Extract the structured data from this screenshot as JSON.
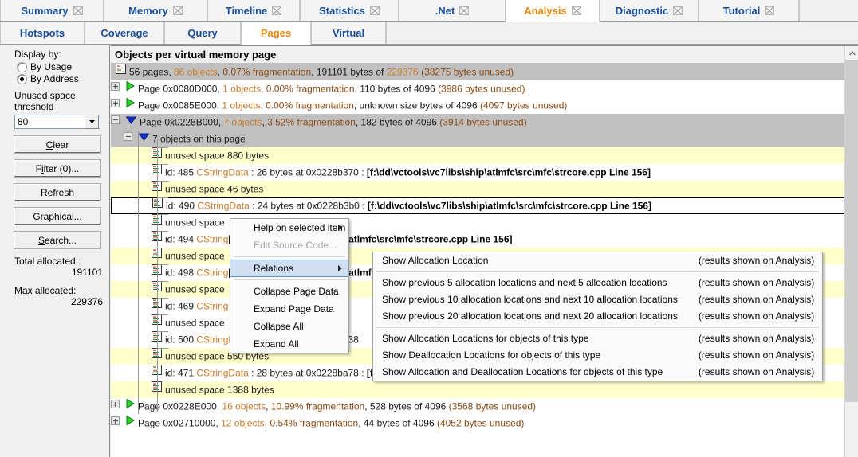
{
  "tabs_primary": [
    {
      "label": "Summary",
      "active": false,
      "closable": true
    },
    {
      "label": "Memory",
      "active": false,
      "closable": true
    },
    {
      "label": "Timeline",
      "active": false,
      "closable": true
    },
    {
      "label": "Statistics",
      "active": false,
      "closable": true
    },
    {
      "label": ".Net",
      "active": false,
      "closable": true
    },
    {
      "label": "Analysis",
      "active": true,
      "closable": true
    },
    {
      "label": "Diagnostic",
      "active": false,
      "closable": true
    },
    {
      "label": "Tutorial",
      "active": false,
      "closable": true
    }
  ],
  "tabs_secondary": [
    {
      "label": "Hotspots",
      "active": false
    },
    {
      "label": "Coverage",
      "active": false
    },
    {
      "label": "Query",
      "active": false
    },
    {
      "label": "Pages",
      "active": true
    },
    {
      "label": "Virtual",
      "active": false
    }
  ],
  "sidebar": {
    "display_by_label": "Display by:",
    "radios": [
      {
        "label": "By Usage",
        "selected": false
      },
      {
        "label": "By Address",
        "selected": true
      }
    ],
    "threshold_label": "Unused space threshold",
    "threshold_value": "80",
    "buttons": [
      {
        "accel": "C",
        "rest": "lear"
      },
      {
        "accel": "F",
        "pre": "",
        "rest": "ilter (0)..."
      },
      {
        "accel": "R",
        "rest": "efresh"
      },
      {
        "accel": "G",
        "rest": "raphical..."
      },
      {
        "accel": "S",
        "rest": "earch..."
      }
    ],
    "button_labels": [
      "Clear",
      "Filter (0)...",
      "Refresh",
      "Graphical...",
      "Search..."
    ],
    "total_allocated_label": "Total allocated:",
    "total_allocated_value": "191101",
    "max_allocated_label": "Max allocated:",
    "max_allocated_value": "229376"
  },
  "main": {
    "title": "Objects per virtual memory page",
    "summary_row": {
      "icon": "list-document-icon",
      "parts": [
        {
          "t": "56 pages, ",
          "c": "dark"
        },
        {
          "t": "86 objects",
          "c": "orange"
        },
        {
          "t": ", ",
          "c": "dark"
        },
        {
          "t": "0.07% fragmentation",
          "c": "brown"
        },
        {
          "t": ", 191101 bytes of ",
          "c": "dark"
        },
        {
          "t": "229376",
          "c": "orange"
        },
        {
          "t": "  (38275 bytes unused)",
          "c": "brown"
        }
      ]
    },
    "rows": [
      {
        "kind": "page",
        "indent": 11,
        "expander": "plus",
        "arrow": "green",
        "parts": [
          {
            "t": "Page 0x0080D000, ",
            "c": "dark"
          },
          {
            "t": "1 objects",
            "c": "orange"
          },
          {
            "t": ", ",
            "c": "dark"
          },
          {
            "t": "0.00% fragmentation",
            "c": "brown"
          },
          {
            "t": ", 110 bytes of 4096",
            "c": "dark"
          },
          {
            "t": "  (3986 bytes unused)",
            "c": "brown"
          }
        ]
      },
      {
        "kind": "page",
        "indent": 11,
        "expander": "plus",
        "arrow": "green",
        "parts": [
          {
            "t": "Page 0x0085E000, ",
            "c": "dark"
          },
          {
            "t": "1 objects",
            "c": "orange"
          },
          {
            "t": ", ",
            "c": "dark"
          },
          {
            "t": "0.00% fragmentation",
            "c": "brown"
          },
          {
            "t": ", unknown size bytes of 4096",
            "c": "dark"
          },
          {
            "t": "  (4097 bytes unused)",
            "c": "brown"
          }
        ]
      },
      {
        "kind": "page-sel",
        "indent": 11,
        "expander": "minus",
        "arrow": "blue",
        "parts": [
          {
            "t": "Page 0x0228B000, ",
            "c": "dark"
          },
          {
            "t": "7 objects",
            "c": "orange"
          },
          {
            "t": ", ",
            "c": "dark"
          },
          {
            "t": "3.52% fragmentation",
            "c": "brown"
          },
          {
            "t": ", 182 bytes of 4096",
            "c": "dark"
          },
          {
            "t": "  (3914 bytes unused)",
            "c": "brown"
          }
        ]
      },
      {
        "kind": "group",
        "indent": 27,
        "expander": "minus",
        "arrow": "blue",
        "parts": [
          {
            "t": "7 objects on this page",
            "c": "dark"
          }
        ]
      },
      {
        "kind": "unused",
        "indent": 51,
        "icon": "list-document-icon",
        "parts": [
          {
            "t": "unused space 880 bytes",
            "c": "dark"
          }
        ]
      },
      {
        "kind": "object",
        "indent": 51,
        "icon": "list-document-icon",
        "parts": [
          {
            "t": "id: 485 ",
            "c": "dark"
          },
          {
            "t": "CStringData",
            "c": "orange"
          },
          {
            "t": " : 26 bytes at 0x0228b370 : ",
            "c": "dark"
          },
          {
            "t": "[f:\\dd\\vctools\\vc7libs\\ship\\atlmfc\\src\\mfc\\strcore.cpp Line 156]",
            "c": "path"
          }
        ]
      },
      {
        "kind": "unused",
        "indent": 51,
        "icon": "list-document-icon",
        "parts": [
          {
            "t": "unused space 46 bytes",
            "c": "dark"
          }
        ]
      },
      {
        "kind": "object-selected",
        "indent": 51,
        "icon": "list-document-icon",
        "parts": [
          {
            "t": "id: 490 ",
            "c": "dark"
          },
          {
            "t": "CStringData",
            "c": "orange"
          },
          {
            "t": " : 24 bytes at 0x0228b3b0 : ",
            "c": "dark"
          },
          {
            "t": "[f:\\dd\\vctools\\vc7libs\\ship\\atlmfc\\src\\mfc\\strcore.cpp Line 156]",
            "c": "path"
          }
        ]
      },
      {
        "kind": "plain",
        "indent": 51,
        "icon": "list-document-icon",
        "parts": [
          {
            "t": "unused space",
            "c": "dark"
          }
        ]
      },
      {
        "kind": "object",
        "indent": 51,
        "icon": "list-document-icon",
        "parts": [
          {
            "t": "id: 494 ",
            "c": "dark"
          },
          {
            "t": "CString",
            "c": "orange"
          },
          {
            "t": "",
            "c": "dark"
          },
          {
            "t": "[f:\\dd\\vctools\\vc7libs\\ship\\atlmfc\\src\\mfc\\strcore.cpp Line 156]",
            "c": "path"
          }
        ]
      },
      {
        "kind": "unused",
        "indent": 51,
        "icon": "list-document-icon",
        "parts": [
          {
            "t": "unused space",
            "c": "dark"
          }
        ]
      },
      {
        "kind": "object",
        "indent": 51,
        "icon": "list-document-icon",
        "parts": [
          {
            "t": "id: 498 ",
            "c": "dark"
          },
          {
            "t": "CString",
            "c": "orange"
          },
          {
            "t": "",
            "c": "dark"
          },
          {
            "t": "[f:\\dd\\vctools\\vc7libs\\ship\\atlmfc\\src\\mfc\\strcore.cpp Line 156]",
            "c": "path"
          }
        ]
      },
      {
        "kind": "unused",
        "indent": 51,
        "icon": "list-document-icon",
        "parts": [
          {
            "t": "unused space",
            "c": "dark"
          }
        ]
      },
      {
        "kind": "object",
        "indent": 51,
        "icon": "list-document-icon",
        "parts": [
          {
            "t": "id: 469 ",
            "c": "dark"
          },
          {
            "t": "CString",
            "c": "orange"
          }
        ]
      },
      {
        "kind": "plain",
        "indent": 51,
        "icon": "list-document-icon",
        "parts": [
          {
            "t": "unused space",
            "c": "dark"
          }
        ]
      },
      {
        "kind": "object",
        "indent": 51,
        "icon": "list-document-icon",
        "parts": [
          {
            "t": "id: 500 ",
            "c": "dark"
          },
          {
            "t": "CStringData",
            "c": "orange"
          },
          {
            "t": " : 26 bytes at 0x0228b838",
            "c": "dark"
          }
        ]
      },
      {
        "kind": "unused",
        "indent": 51,
        "icon": "list-document-icon",
        "parts": [
          {
            "t": "unused space 550 bytes",
            "c": "dark"
          }
        ]
      },
      {
        "kind": "object",
        "indent": 51,
        "icon": "list-document-icon",
        "parts": [
          {
            "t": "id: 471 ",
            "c": "dark"
          },
          {
            "t": "CStringData",
            "c": "orange"
          },
          {
            "t": " : 28 bytes at 0x0228ba78 : ",
            "c": "dark"
          },
          {
            "t": "[f:\\dd\\vctools\\vc7libs\\ship\\atlmfc\\src\\mfc\\strcore.cpp Line 156]",
            "c": "path"
          }
        ]
      },
      {
        "kind": "unused",
        "indent": 51,
        "icon": "list-document-icon",
        "parts": [
          {
            "t": "unused space 1388 bytes",
            "c": "dark"
          }
        ]
      },
      {
        "kind": "page",
        "indent": 11,
        "expander": "plus",
        "arrow": "green",
        "parts": [
          {
            "t": "Page 0x0228E000, ",
            "c": "dark"
          },
          {
            "t": "16 objects",
            "c": "orange"
          },
          {
            "t": ", ",
            "c": "dark"
          },
          {
            "t": "10.99% fragmentation",
            "c": "brown"
          },
          {
            "t": ", 528 bytes of 4096",
            "c": "dark"
          },
          {
            "t": "  (3568 bytes unused)",
            "c": "brown"
          }
        ]
      },
      {
        "kind": "page",
        "indent": 11,
        "expander": "plus",
        "arrow": "green",
        "parts": [
          {
            "t": "Page 0x02710000, ",
            "c": "dark"
          },
          {
            "t": "12 objects",
            "c": "orange"
          },
          {
            "t": ", ",
            "c": "dark"
          },
          {
            "t": "0.54% fragmentation",
            "c": "brown"
          },
          {
            "t": ", 44 bytes of 4096",
            "c": "dark"
          },
          {
            "t": "  (4052 bytes unused)",
            "c": "brown"
          }
        ]
      }
    ]
  },
  "context_menu": {
    "items": [
      {
        "label": "Help on selected item",
        "submenu": true,
        "disabled": false,
        "highlighted": false
      },
      {
        "label": "Edit Source Code...",
        "submenu": false,
        "disabled": true,
        "highlighted": false
      },
      {
        "separator": true
      },
      {
        "label": "Relations",
        "submenu": true,
        "disabled": false,
        "highlighted": true
      },
      {
        "separator": true
      },
      {
        "label": "Collapse Page Data",
        "submenu": false,
        "disabled": false,
        "highlighted": false
      },
      {
        "label": "Expand Page Data",
        "submenu": false,
        "disabled": false,
        "highlighted": false
      },
      {
        "label": "Collapse All",
        "submenu": false,
        "disabled": false,
        "highlighted": false
      },
      {
        "label": "Expand All",
        "submenu": false,
        "disabled": false,
        "highlighted": false
      }
    ]
  },
  "submenu": {
    "items": [
      {
        "label": "Show Allocation Location",
        "note": "(results shown on Analysis)"
      },
      {
        "separator": true
      },
      {
        "label": "Show previous 5 allocation locations and next 5 allocation locations",
        "note": "(results shown on Analysis)"
      },
      {
        "label": "Show previous 10 allocation locations and next 10 allocation locations",
        "note": "(results shown on Analysis)"
      },
      {
        "label": "Show previous 20 allocation locations and next 20 allocation locations",
        "note": "(results shown on Analysis)"
      },
      {
        "separator": true
      },
      {
        "label": "Show Allocation Locations for objects of this type",
        "note": "(results shown on Analysis)"
      },
      {
        "label": "Show Deallocation Locations for objects of this type",
        "note": "(results shown on Analysis)"
      },
      {
        "label": "Show Allocation and Deallocation Locations for objects of this type",
        "note": "(results shown on Analysis)"
      }
    ]
  },
  "colors": {
    "accent_active_tab": "#e8880c",
    "tab_text": "#1a4f9c",
    "unused_row": "#ffffcc",
    "selected_page_row": "#c0c0c0",
    "menu_highlight": "#cfe0f2",
    "type_name": "#c87a2a",
    "fragmentation": "#8a4a12"
  }
}
